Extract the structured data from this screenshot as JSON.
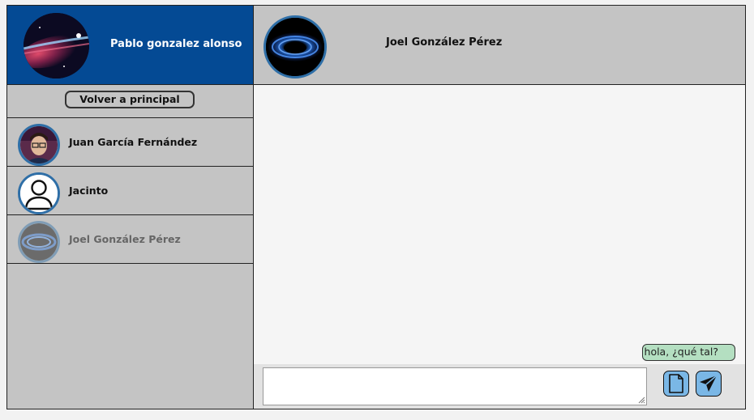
{
  "current_user": {
    "name": "Pablo gonzalez alonso",
    "avatar": "nebula-avatar"
  },
  "sidebar": {
    "back_label": "Volver a principal",
    "contacts": [
      {
        "name": "Juan García Fernández",
        "avatar": "photo-avatar",
        "selected": false
      },
      {
        "name": "Jacinto",
        "avatar": "user-silhouette-icon",
        "selected": false
      },
      {
        "name": "Joel González Pérez",
        "avatar": "galaxy-avatar",
        "selected": true
      }
    ]
  },
  "chat": {
    "title": "Joel González Pérez",
    "avatar": "galaxy-avatar",
    "messages": [
      {
        "text": "hola, ¿qué tal?",
        "from": "me"
      }
    ],
    "input_value": "",
    "attach_icon": "file-icon",
    "send_icon": "paper-plane-icon"
  },
  "colors": {
    "header_blue": "#044a94",
    "panel_gray": "#c4c4c4",
    "bubble_green": "#b4dfc1",
    "button_blue": "#7ab7e6",
    "avatar_ring": "#2f6fa7"
  }
}
